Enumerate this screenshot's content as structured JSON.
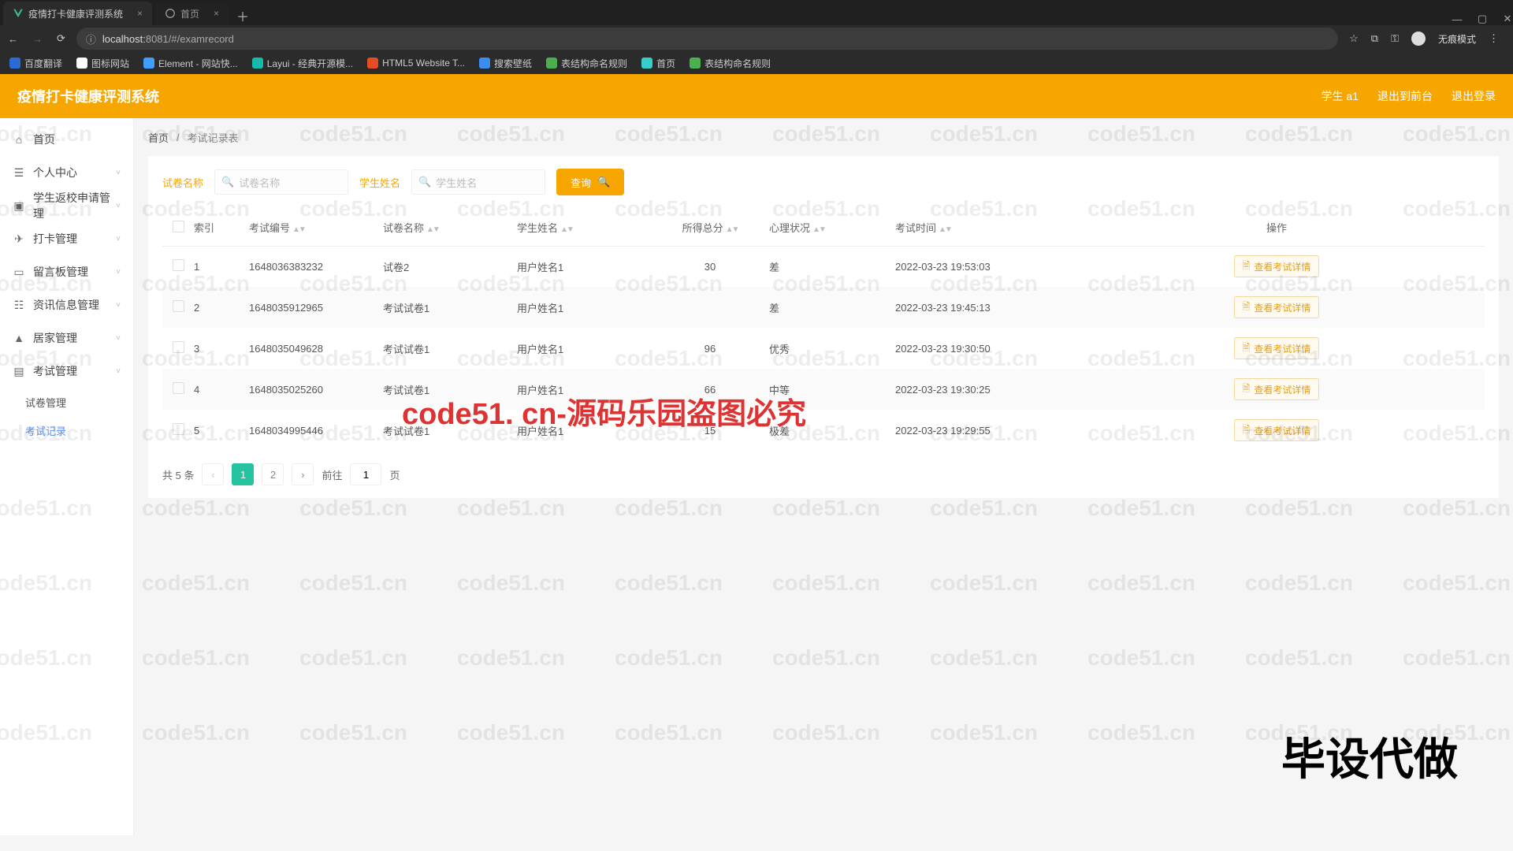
{
  "browser": {
    "tabs": [
      {
        "title": "疫情打卡健康评测系统",
        "active": true
      },
      {
        "title": "首页",
        "active": false
      }
    ],
    "url_host": "localhost:",
    "url_port_path": "8081/#/examrecord",
    "incognito_label": "无痕模式",
    "bookmarks": [
      {
        "label": "百度翻译",
        "color": "#2b6cd4"
      },
      {
        "label": "图标网站",
        "color": "#fff"
      },
      {
        "label": "Element - 网站快...",
        "color": "#409eff"
      },
      {
        "label": "Layui - 经典开源模...",
        "color": "#16baaa"
      },
      {
        "label": "HTML5 Website T...",
        "color": "#e44d26"
      },
      {
        "label": "搜索壁纸",
        "color": "#3b8ef0"
      },
      {
        "label": "表结构命名规则",
        "color": "#4caf50"
      },
      {
        "label": "首页",
        "color": "#36cfc9"
      },
      {
        "label": "表结构命名规则",
        "color": "#4caf50"
      }
    ]
  },
  "header": {
    "logo": "疫情打卡健康评测系统",
    "user_label": "学生 a1",
    "exit_front": "退出到前台",
    "logout": "退出登录"
  },
  "sidebar": {
    "items": [
      {
        "icon": "⌂",
        "label": "首页"
      },
      {
        "icon": "☰",
        "label": "个人中心",
        "expand": true
      },
      {
        "icon": "▣",
        "label": "学生返校申请管理",
        "expand": true
      },
      {
        "icon": "✈",
        "label": "打卡管理",
        "expand": true
      },
      {
        "icon": "▭",
        "label": "留言板管理",
        "expand": true
      },
      {
        "icon": "☷",
        "label": "资讯信息管理",
        "expand": true
      },
      {
        "icon": "▲",
        "label": "居家管理",
        "expand": true
      },
      {
        "icon": "▤",
        "label": "考试管理",
        "expand": true
      }
    ],
    "subs": [
      {
        "label": "试卷管理",
        "active": false
      },
      {
        "label": "考试记录",
        "active": true
      }
    ]
  },
  "crumb": {
    "home": "首页",
    "sep": "/",
    "current": "考试记录表"
  },
  "filters": {
    "paper_label": "试卷名称",
    "paper_ph": "试卷名称",
    "student_label": "学生姓名",
    "student_ph": "学生姓名",
    "search_btn": "查询"
  },
  "table": {
    "headers": {
      "index": "索引",
      "exam_no": "考试编号",
      "paper": "试卷名称",
      "student": "学生姓名",
      "score": "所得总分",
      "psych": "心理状况",
      "time": "考试时间",
      "operate": "操作"
    },
    "op_label": "查看考试详情",
    "rows": [
      {
        "idx": "1",
        "no": "1648036383232",
        "paper": "试卷2",
        "student": "用户姓名1",
        "score": "30",
        "psych": "差",
        "time": "2022-03-23 19:53:03"
      },
      {
        "idx": "2",
        "no": "1648035912965",
        "paper": "考试试卷1",
        "student": "用户姓名1",
        "score": "",
        "psych": "差",
        "time": "2022-03-23 19:45:13"
      },
      {
        "idx": "3",
        "no": "1648035049628",
        "paper": "考试试卷1",
        "student": "用户姓名1",
        "score": "96",
        "psych": "优秀",
        "time": "2022-03-23 19:30:50"
      },
      {
        "idx": "4",
        "no": "1648035025260",
        "paper": "考试试卷1",
        "student": "用户姓名1",
        "score": "66",
        "psych": "中等",
        "time": "2022-03-23 19:30:25"
      },
      {
        "idx": "5",
        "no": "1648034995446",
        "paper": "考试试卷1",
        "student": "用户姓名1",
        "score": "15",
        "psych": "极差",
        "time": "2022-03-23 19:29:55"
      }
    ]
  },
  "pager": {
    "total_text": "共 5 条",
    "pages": [
      "1",
      "2"
    ],
    "goto_prefix": "前往",
    "goto_value": "1",
    "goto_suffix": "页"
  },
  "watermark": {
    "text": "code51.cn",
    "big": "code51. cn-源码乐园盗图必究",
    "corner": "毕设代做"
  }
}
